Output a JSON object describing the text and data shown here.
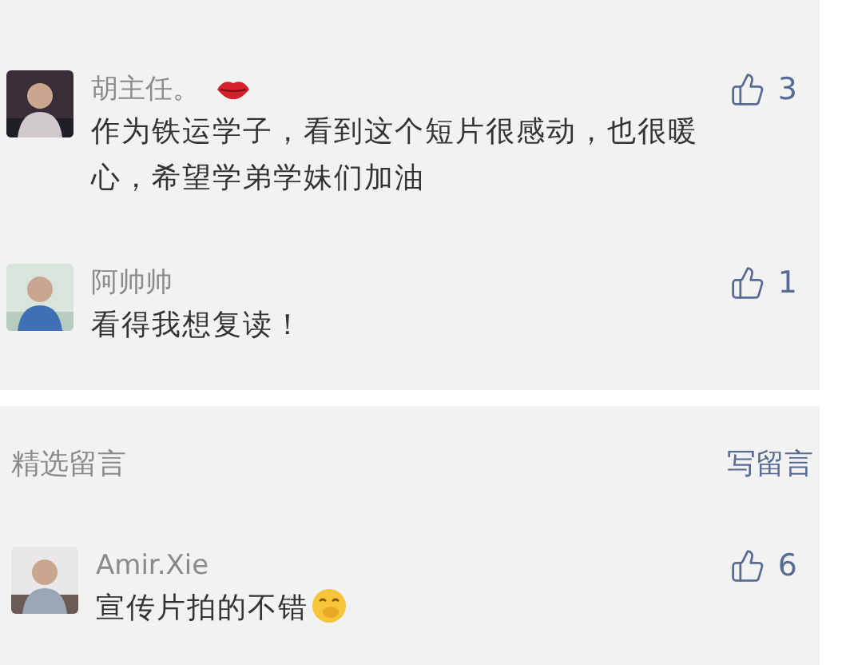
{
  "sections": [
    {
      "comments": [
        {
          "name": "胡主任。",
          "name_badge": true,
          "text": "作为铁运学子，看到这个短片很感动，也很暖心，希望学弟学妹们加油",
          "ends_with_emoji": false,
          "likes": "3"
        },
        {
          "name": "阿帅帅",
          "name_badge": false,
          "text": "看得我想复读！",
          "ends_with_emoji": false,
          "likes": "1"
        }
      ]
    },
    {
      "header": {
        "title": "精选留言",
        "action": "写留言"
      },
      "comments": [
        {
          "name": "Amir.Xie",
          "name_badge": false,
          "text": "宣传片拍的不错",
          "ends_with_emoji": true,
          "likes": "6"
        }
      ]
    }
  ]
}
